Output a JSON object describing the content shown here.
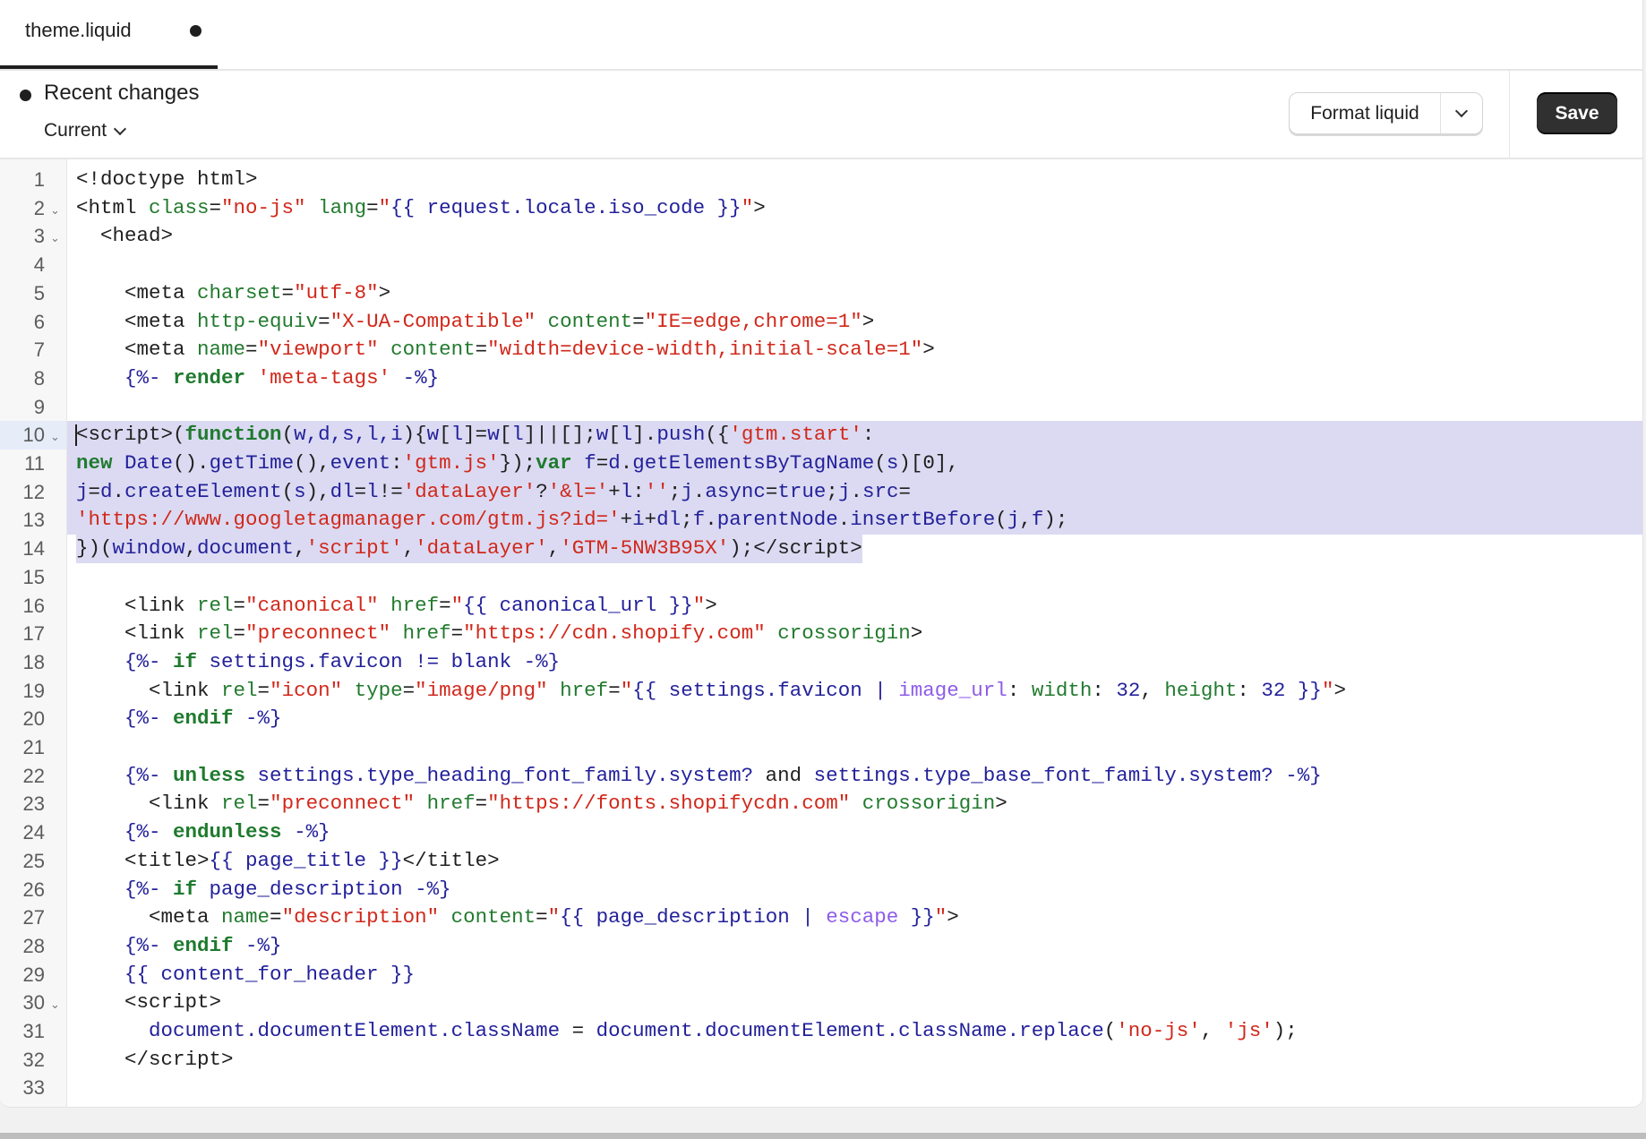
{
  "tab": {
    "label": "theme.liquid",
    "unsaved": true
  },
  "toolbar": {
    "recent_changes_label": "Recent changes",
    "version_select": "Current",
    "format_button": "Format liquid",
    "save_button": "Save"
  },
  "colors": {
    "save_bg": "#303030",
    "selection": "#dbdaf2"
  },
  "editor": {
    "selected_lines": [
      10,
      14
    ],
    "active_line": 10,
    "fold_lines": [
      2,
      3,
      10,
      30
    ],
    "lines": [
      [
        [
          "p",
          "<!doctype html>"
        ]
      ],
      [
        [
          "p",
          "<html "
        ],
        [
          "a",
          "class"
        ],
        [
          "p",
          "="
        ],
        [
          "s",
          "\"no-js\""
        ],
        [
          "p",
          " "
        ],
        [
          "a",
          "lang"
        ],
        [
          "p",
          "="
        ],
        [
          "s",
          "\""
        ],
        [
          "v",
          "{{ request.locale.iso_code }}"
        ],
        [
          "s",
          "\""
        ],
        [
          "p",
          ">"
        ]
      ],
      [
        [
          "p",
          "  <head>"
        ]
      ],
      [],
      [
        [
          "p",
          "    <meta "
        ],
        [
          "a",
          "charset"
        ],
        [
          "p",
          "="
        ],
        [
          "s",
          "\"utf-8\""
        ],
        [
          "p",
          ">"
        ]
      ],
      [
        [
          "p",
          "    <meta "
        ],
        [
          "a",
          "http-equiv"
        ],
        [
          "p",
          "="
        ],
        [
          "s",
          "\"X-UA-Compatible\""
        ],
        [
          "p",
          " "
        ],
        [
          "a",
          "content"
        ],
        [
          "p",
          "="
        ],
        [
          "s",
          "\"IE=edge,chrome=1\""
        ],
        [
          "p",
          ">"
        ]
      ],
      [
        [
          "p",
          "    <meta "
        ],
        [
          "a",
          "name"
        ],
        [
          "p",
          "="
        ],
        [
          "s",
          "\"viewport\""
        ],
        [
          "p",
          " "
        ],
        [
          "a",
          "content"
        ],
        [
          "p",
          "="
        ],
        [
          "s",
          "\"width=device-width,initial-scale=1\""
        ],
        [
          "p",
          ">"
        ]
      ],
      [
        [
          "v",
          "    {%- "
        ],
        [
          "k",
          "render"
        ],
        [
          "p",
          " "
        ],
        [
          "s",
          "'meta-tags'"
        ],
        [
          "v",
          " -%}"
        ]
      ],
      [],
      [
        [
          "p",
          "<script>("
        ],
        [
          "k",
          "function"
        ],
        [
          "p",
          "("
        ],
        [
          "v",
          "w,d,s,l,i"
        ],
        [
          "p",
          "){"
        ],
        [
          "v",
          "w"
        ],
        [
          "p",
          "["
        ],
        [
          "v",
          "l"
        ],
        [
          "p",
          "]="
        ],
        [
          "v",
          "w"
        ],
        [
          "p",
          "["
        ],
        [
          "v",
          "l"
        ],
        [
          "p",
          "]||[];"
        ],
        [
          "v",
          "w"
        ],
        [
          "p",
          "["
        ],
        [
          "v",
          "l"
        ],
        [
          "p",
          "]."
        ],
        [
          "v",
          "push"
        ],
        [
          "p",
          "({"
        ],
        [
          "s",
          "'gtm.start'"
        ],
        [
          "p",
          ":"
        ]
      ],
      [
        [
          "k",
          "new"
        ],
        [
          "p",
          " "
        ],
        [
          "v",
          "Date"
        ],
        [
          "p",
          "()."
        ],
        [
          "v",
          "getTime"
        ],
        [
          "p",
          "(),"
        ],
        [
          "v",
          "event"
        ],
        [
          "p",
          ":"
        ],
        [
          "s",
          "'gtm.js'"
        ],
        [
          "p",
          "});"
        ],
        [
          "k",
          "var"
        ],
        [
          "p",
          " "
        ],
        [
          "v",
          "f"
        ],
        [
          "p",
          "="
        ],
        [
          "v",
          "d"
        ],
        [
          "p",
          "."
        ],
        [
          "v",
          "getElementsByTagName"
        ],
        [
          "p",
          "("
        ],
        [
          "v",
          "s"
        ],
        [
          "p",
          ")[0],"
        ]
      ],
      [
        [
          "v",
          "j"
        ],
        [
          "p",
          "="
        ],
        [
          "v",
          "d"
        ],
        [
          "p",
          "."
        ],
        [
          "v",
          "createElement"
        ],
        [
          "p",
          "("
        ],
        [
          "v",
          "s"
        ],
        [
          "p",
          "),"
        ],
        [
          "v",
          "dl"
        ],
        [
          "p",
          "="
        ],
        [
          "v",
          "l"
        ],
        [
          "p",
          "!="
        ],
        [
          "s",
          "'dataLayer'"
        ],
        [
          "p",
          "?"
        ],
        [
          "s",
          "'&l='"
        ],
        [
          "p",
          "+"
        ],
        [
          "v",
          "l"
        ],
        [
          "p",
          ":"
        ],
        [
          "s",
          "''"
        ],
        [
          "p",
          ";"
        ],
        [
          "v",
          "j"
        ],
        [
          "p",
          "."
        ],
        [
          "v",
          "async"
        ],
        [
          "p",
          "="
        ],
        [
          "v",
          "true"
        ],
        [
          "p",
          ";"
        ],
        [
          "v",
          "j"
        ],
        [
          "p",
          "."
        ],
        [
          "v",
          "src"
        ],
        [
          "p",
          "="
        ]
      ],
      [
        [
          "s",
          "'https://www.googletagmanager.com/gtm.js?id='"
        ],
        [
          "p",
          "+"
        ],
        [
          "v",
          "i"
        ],
        [
          "p",
          "+"
        ],
        [
          "v",
          "dl"
        ],
        [
          "p",
          ";"
        ],
        [
          "v",
          "f"
        ],
        [
          "p",
          "."
        ],
        [
          "v",
          "parentNode"
        ],
        [
          "p",
          "."
        ],
        [
          "v",
          "insertBefore"
        ],
        [
          "p",
          "("
        ],
        [
          "v",
          "j"
        ],
        [
          "p",
          ","
        ],
        [
          "v",
          "f"
        ],
        [
          "p",
          ");"
        ]
      ],
      [
        [
          "p",
          "})("
        ],
        [
          "v",
          "window"
        ],
        [
          "p",
          ","
        ],
        [
          "v",
          "document"
        ],
        [
          "p",
          ","
        ],
        [
          "s",
          "'script'"
        ],
        [
          "p",
          ","
        ],
        [
          "s",
          "'dataLayer'"
        ],
        [
          "p",
          ","
        ],
        [
          "s",
          "'GTM-5NW3B95X'"
        ],
        [
          "p",
          ");</script>"
        ]
      ],
      [],
      [
        [
          "p",
          "    <link "
        ],
        [
          "a",
          "rel"
        ],
        [
          "p",
          "="
        ],
        [
          "s",
          "\"canonical\""
        ],
        [
          "p",
          " "
        ],
        [
          "a",
          "href"
        ],
        [
          "p",
          "="
        ],
        [
          "s",
          "\""
        ],
        [
          "v",
          "{{ canonical_url }}"
        ],
        [
          "s",
          "\""
        ],
        [
          "p",
          ">"
        ]
      ],
      [
        [
          "p",
          "    <link "
        ],
        [
          "a",
          "rel"
        ],
        [
          "p",
          "="
        ],
        [
          "s",
          "\"preconnect\""
        ],
        [
          "p",
          " "
        ],
        [
          "a",
          "href"
        ],
        [
          "p",
          "="
        ],
        [
          "s",
          "\"https://cdn.shopify.com\""
        ],
        [
          "p",
          " "
        ],
        [
          "a",
          "crossorigin"
        ],
        [
          "p",
          ">"
        ]
      ],
      [
        [
          "v",
          "    {%- "
        ],
        [
          "k",
          "if"
        ],
        [
          "v",
          " settings.favicon != blank -%}"
        ]
      ],
      [
        [
          "p",
          "      <link "
        ],
        [
          "a",
          "rel"
        ],
        [
          "p",
          "="
        ],
        [
          "s",
          "\"icon\""
        ],
        [
          "p",
          " "
        ],
        [
          "a",
          "type"
        ],
        [
          "p",
          "="
        ],
        [
          "s",
          "\"image/png\""
        ],
        [
          "p",
          " "
        ],
        [
          "a",
          "href"
        ],
        [
          "p",
          "="
        ],
        [
          "s",
          "\""
        ],
        [
          "v",
          "{{ settings.favicon | "
        ],
        [
          "f",
          "image_url"
        ],
        [
          "p",
          ": "
        ],
        [
          "a",
          "width"
        ],
        [
          "p",
          ": "
        ],
        [
          "v",
          "32"
        ],
        [
          "p",
          ", "
        ],
        [
          "a",
          "height"
        ],
        [
          "p",
          ": "
        ],
        [
          "v",
          "32 }}"
        ],
        [
          "s",
          "\""
        ],
        [
          "p",
          ">"
        ]
      ],
      [
        [
          "v",
          "    {%- "
        ],
        [
          "k",
          "endif"
        ],
        [
          "v",
          " -%}"
        ]
      ],
      [],
      [
        [
          "v",
          "    {%- "
        ],
        [
          "k",
          "unless"
        ],
        [
          "v",
          " settings.type_heading_font_family.system? "
        ],
        [
          "p",
          "and"
        ],
        [
          "v",
          " settings.type_base_font_family.system? -%}"
        ]
      ],
      [
        [
          "p",
          "      <link "
        ],
        [
          "a",
          "rel"
        ],
        [
          "p",
          "="
        ],
        [
          "s",
          "\"preconnect\""
        ],
        [
          "p",
          " "
        ],
        [
          "a",
          "href"
        ],
        [
          "p",
          "="
        ],
        [
          "s",
          "\"https://fonts.shopifycdn.com\""
        ],
        [
          "p",
          " "
        ],
        [
          "a",
          "crossorigin"
        ],
        [
          "p",
          ">"
        ]
      ],
      [
        [
          "v",
          "    {%- "
        ],
        [
          "k",
          "endunless"
        ],
        [
          "v",
          " -%}"
        ]
      ],
      [
        [
          "p",
          "    <title>"
        ],
        [
          "v",
          "{{ page_title }}"
        ],
        [
          "p",
          "</title>"
        ]
      ],
      [
        [
          "v",
          "    {%- "
        ],
        [
          "k",
          "if"
        ],
        [
          "v",
          " page_description -%}"
        ]
      ],
      [
        [
          "p",
          "      <meta "
        ],
        [
          "a",
          "name"
        ],
        [
          "p",
          "="
        ],
        [
          "s",
          "\"description\""
        ],
        [
          "p",
          " "
        ],
        [
          "a",
          "content"
        ],
        [
          "p",
          "="
        ],
        [
          "s",
          "\""
        ],
        [
          "v",
          "{{ page_description | "
        ],
        [
          "f",
          "escape"
        ],
        [
          "v",
          " }}"
        ],
        [
          "s",
          "\""
        ],
        [
          "p",
          ">"
        ]
      ],
      [
        [
          "v",
          "    {%- "
        ],
        [
          "k",
          "endif"
        ],
        [
          "v",
          " -%}"
        ]
      ],
      [
        [
          "v",
          "    {{ content_for_header }}"
        ]
      ],
      [
        [
          "p",
          "    <script>"
        ]
      ],
      [
        [
          "p",
          "      "
        ],
        [
          "v",
          "document.documentElement.className"
        ],
        [
          "p",
          " = "
        ],
        [
          "v",
          "document.documentElement.className.replace"
        ],
        [
          "p",
          "("
        ],
        [
          "s",
          "'no-js'"
        ],
        [
          "p",
          ", "
        ],
        [
          "s",
          "'js'"
        ],
        [
          "p",
          ");"
        ]
      ],
      [
        [
          "p",
          "    </script>"
        ]
      ],
      []
    ]
  }
}
